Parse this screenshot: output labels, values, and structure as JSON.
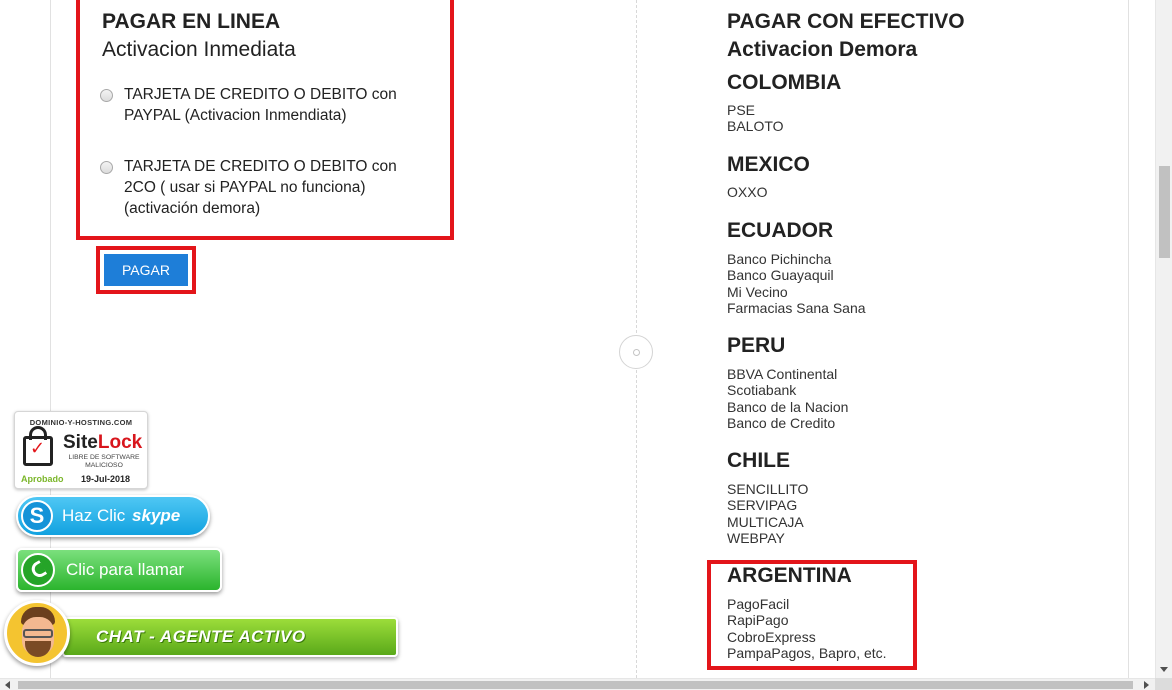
{
  "online": {
    "title": "PAGAR EN LINEA",
    "subtitle": "Activacion Inmediata",
    "options": [
      {
        "label": "TARJETA DE CREDITO O DEBITO con PAYPAL (Activacion Inmendiata)"
      },
      {
        "label": "TARJETA DE CREDITO O DEBITO con 2CO ( usar si PAYPAL no funciona) (activación demora)"
      }
    ],
    "pay_button": "PAGAR"
  },
  "cash": {
    "title": "PAGAR CON EFECTIVO",
    "subtitle": "Activacion Demora",
    "countries": [
      {
        "name": "COLOMBIA",
        "methods": [
          "PSE",
          "BALOTO"
        ]
      },
      {
        "name": "MEXICO",
        "methods": [
          "OXXO"
        ]
      },
      {
        "name": "ECUADOR",
        "methods": [
          "Banco Pichincha",
          "Banco Guayaquil",
          "Mi Vecino",
          "Farmacias Sana Sana"
        ]
      },
      {
        "name": "PERU",
        "methods": [
          "BBVA Continental",
          "Scotiabank",
          "Banco de la Nacion",
          "Banco de Credito"
        ]
      },
      {
        "name": "CHILE",
        "methods": [
          "SENCILLITO",
          "SERVIPAG",
          "MULTICAJA",
          "WEBPAY"
        ]
      },
      {
        "name": "ARGENTINA",
        "methods": [
          "PagoFacil",
          "RapiPago",
          "CobroExpress",
          "PampaPagos, Bapro, etc."
        ]
      }
    ]
  },
  "widgets": {
    "sitelock": {
      "domain": "DOMINIO-Y-HOSTING.COM",
      "brand_site": "Site",
      "brand_lock": "Lock",
      "tagline": "LIBRE DE SOFTWARE MALICIOSO",
      "approved": "Aprobado",
      "date": "19-Jul-2018"
    },
    "skype": {
      "label": "Haz Clic",
      "brand": "skype"
    },
    "whatsapp": {
      "label": "Clic para llamar"
    },
    "chat": {
      "label": "CHAT - AGENTE ACTIVO"
    }
  },
  "colors": {
    "highlight_border": "#e3151a",
    "pay_button": "#1e7ed8",
    "skype": "#12a2e0",
    "whatsapp": "#2bb42d",
    "chat": "#5aa91a"
  }
}
